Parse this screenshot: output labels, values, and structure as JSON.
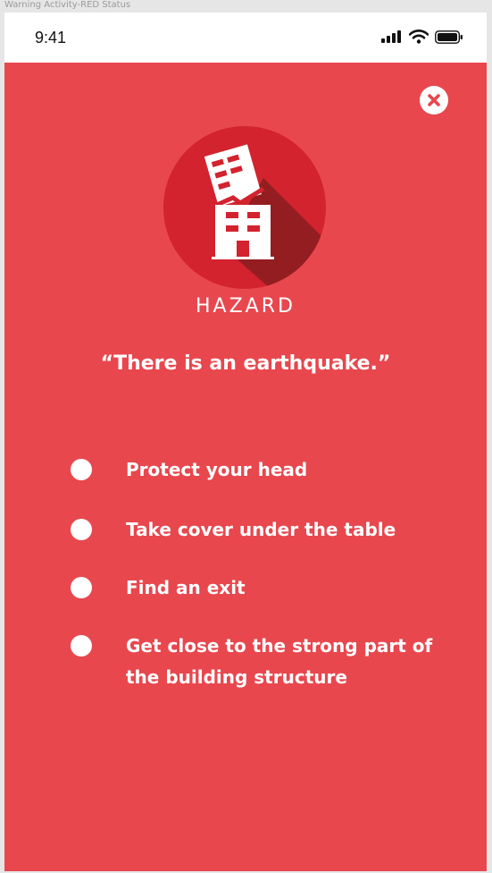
{
  "frame": {
    "title": "Warning Activity-RED Status"
  },
  "status_bar": {
    "time": "9:41"
  },
  "alert": {
    "category": "HAZARD",
    "message": "“There is an earthquake.”",
    "icon": "collapsing-building-icon",
    "background_color": "#e8474e",
    "icon_circle_color": "#d2232e"
  },
  "steps": [
    {
      "text": "Protect your head"
    },
    {
      "text": "Take cover under the table"
    },
    {
      "text": "Find an exit"
    },
    {
      "text": "Get close to the strong part of the building structure"
    }
  ]
}
